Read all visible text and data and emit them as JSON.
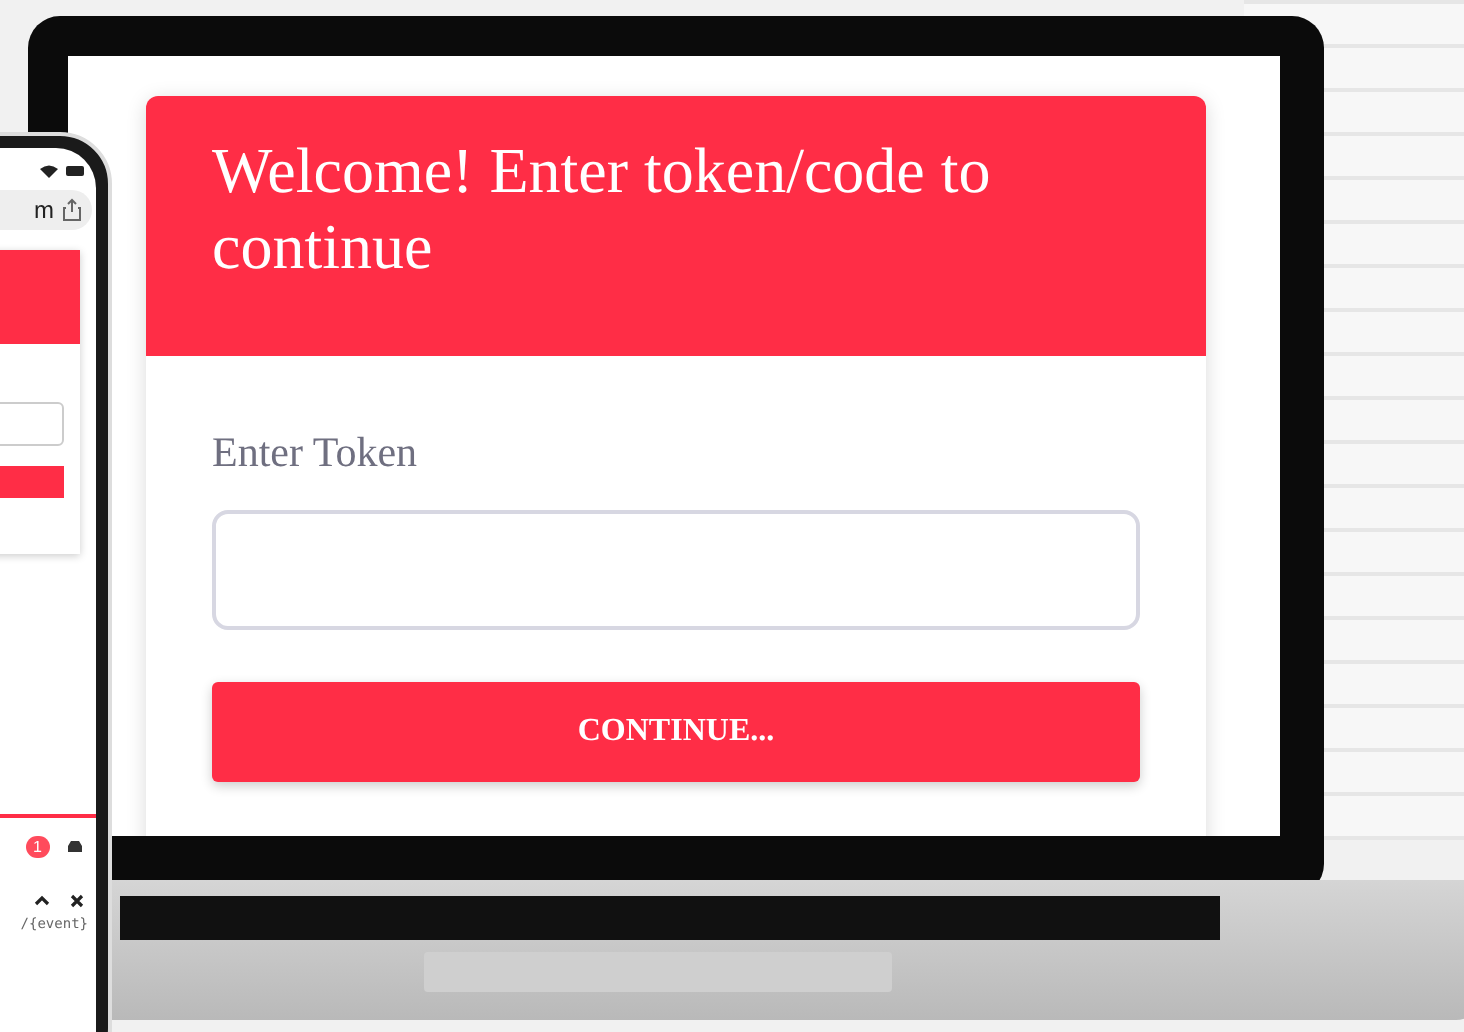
{
  "laptop_page": {
    "heading": "Welcome! Enter token/code to continue",
    "token_label": "Enter Token",
    "continue_button": "CONTINUE..."
  },
  "phone_page": {
    "url_fragment": "m",
    "notification_count": "1",
    "footer_text": "/{event}"
  }
}
